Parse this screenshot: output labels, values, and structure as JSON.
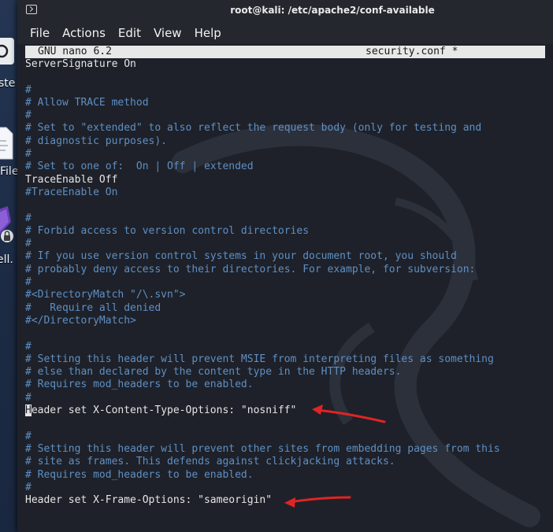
{
  "window": {
    "title": "root@kali: /etc/apache2/conf-available"
  },
  "menu": [
    "File",
    "Actions",
    "Edit",
    "View",
    "Help"
  ],
  "nano": {
    "version": "GNU nano 6.2",
    "filename": "security.conf *"
  },
  "desktop_icons": [
    {
      "name": "terminal-icon",
      "label": "ste"
    },
    {
      "name": "file-icon",
      "label": "File"
    },
    {
      "name": "shell-icon",
      "label": "ell."
    }
  ],
  "lines": [
    {
      "type": "code",
      "text": "ServerSignature On"
    },
    {
      "type": "blank",
      "text": ""
    },
    {
      "type": "comment",
      "text": "#"
    },
    {
      "type": "comment",
      "text": "# Allow TRACE method"
    },
    {
      "type": "comment",
      "text": "#"
    },
    {
      "type": "comment",
      "text": "# Set to \"extended\" to also reflect the request body (only for testing and"
    },
    {
      "type": "comment",
      "text": "# diagnostic purposes)."
    },
    {
      "type": "comment",
      "text": "#"
    },
    {
      "type": "comment",
      "text": "# Set to one of:  On | Off | extended"
    },
    {
      "type": "code",
      "text": "TraceEnable Off"
    },
    {
      "type": "comment",
      "text": "#TraceEnable On"
    },
    {
      "type": "blank",
      "text": ""
    },
    {
      "type": "comment",
      "text": "#"
    },
    {
      "type": "comment",
      "text": "# Forbid access to version control directories"
    },
    {
      "type": "comment",
      "text": "#"
    },
    {
      "type": "comment",
      "text": "# If you use version control systems in your document root, you should"
    },
    {
      "type": "comment",
      "text": "# probably deny access to their directories. For example, for subversion:"
    },
    {
      "type": "comment",
      "text": "#"
    },
    {
      "type": "comment",
      "text": "#<DirectoryMatch \"/\\.svn\">"
    },
    {
      "type": "comment",
      "text": "#   Require all denied"
    },
    {
      "type": "comment",
      "text": "#</DirectoryMatch>"
    },
    {
      "type": "blank",
      "text": ""
    },
    {
      "type": "comment",
      "text": "#"
    },
    {
      "type": "comment",
      "text": "# Setting this header will prevent MSIE from interpreting files as something"
    },
    {
      "type": "comment",
      "text": "# else than declared by the content type in the HTTP headers."
    },
    {
      "type": "comment",
      "text": "# Requires mod_headers to be enabled."
    },
    {
      "type": "comment",
      "text": "#"
    },
    {
      "type": "cursor",
      "cursor_char": "H",
      "text": "eader set X-Content-Type-Options: \"nosniff\""
    },
    {
      "type": "blank",
      "text": ""
    },
    {
      "type": "comment",
      "text": "#"
    },
    {
      "type": "comment",
      "text": "# Setting this header will prevent other sites from embedding pages from this"
    },
    {
      "type": "comment",
      "text": "# site as frames. This defends against clickjacking attacks."
    },
    {
      "type": "comment",
      "text": "# Requires mod_headers to be enabled."
    },
    {
      "type": "comment",
      "text": "#"
    },
    {
      "type": "code",
      "text": "Header set X-Frame-Options: \"sameorigin\""
    }
  ],
  "colors": {
    "comment": "#5f8fc4",
    "code": "#e6e6e6",
    "annotation_arrow": "#e02424"
  }
}
